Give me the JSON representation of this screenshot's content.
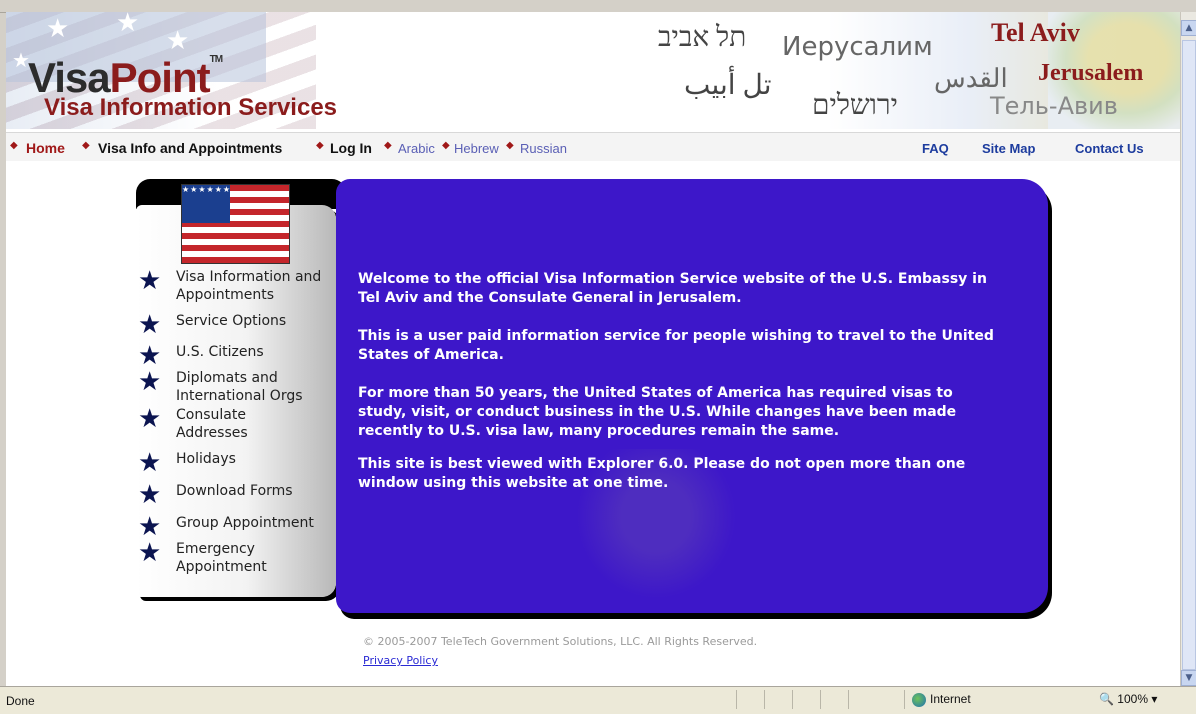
{
  "banner": {
    "logo_visa": "Visa",
    "logo_point": "Point",
    "logo_tm": "TM",
    "tagline": "Visa Information Services",
    "cities": {
      "tel_aviv_he": "תל אביב",
      "jerusalem_ru": "Иерусалим",
      "tel_aviv_en": "Tel Aviv",
      "tel_aviv_ar": "تل أبيب",
      "jerusalem_ar": "القدس",
      "jerusalem_en": "Jerusalem",
      "jerusalem_he": "ירושלים",
      "tel_aviv_ru": "Тель-Авив"
    }
  },
  "nav": {
    "home": "Home",
    "visa_info": "Visa Info and Appointments",
    "login": "Log In",
    "arabic": "Arabic",
    "hebrew": "Hebrew",
    "russian": "Russian",
    "faq": "FAQ",
    "site_map": "Site Map",
    "contact_us": "Contact Us"
  },
  "sidebar": {
    "items": [
      {
        "label": "Visa Information and Appointments"
      },
      {
        "label": "Service Options"
      },
      {
        "label": "U.S. Citizens"
      },
      {
        "label": "Diplomats and International Orgs"
      },
      {
        "label": "Consulate Addresses"
      },
      {
        "label": "Holidays"
      },
      {
        "label": "Download Forms"
      },
      {
        "label": "Group Appointment"
      },
      {
        "label": "Emergency Appointment"
      }
    ]
  },
  "main": {
    "paragraphs": [
      "Welcome to the official Visa Information Service website of the U.S. Embassy in Tel Aviv and the Consulate General in Jerusalem.",
      "This is a user paid information service for people wishing to travel to the United States of America.",
      "For more than 50 years, the United States of America has required visas to study, visit, or conduct business in the U.S. While changes have been made recently to U.S. visa law, many procedures remain the same.",
      "This site is best viewed with Explorer 6.0.  Please do not open more than one window using this website at one time."
    ]
  },
  "footer": {
    "copyright": "© 2005-2007 TeleTech Government Solutions, LLC. All Rights Reserved.",
    "privacy": "Privacy Policy"
  },
  "statusbar": {
    "status": "Done",
    "zone": "Internet",
    "zoom": "100%"
  },
  "colors": {
    "panel_blue": "#3d17c9",
    "brand_red": "#8b1c1c",
    "nav_link_blue": "#1d3c9e"
  }
}
